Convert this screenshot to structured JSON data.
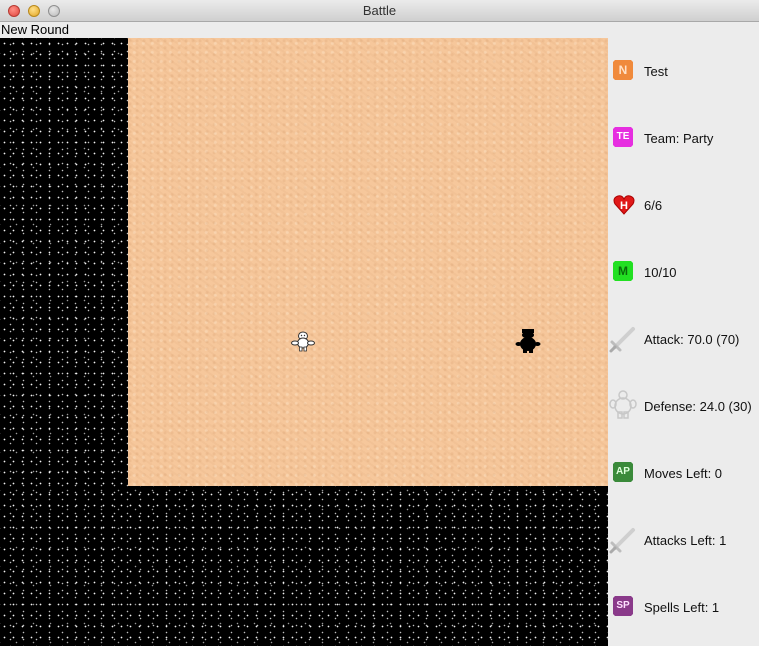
{
  "window": {
    "title": "Battle"
  },
  "menu": {
    "new_round": "New Round"
  },
  "stats": {
    "name": {
      "icon": "N",
      "label": "Test",
      "color": "#f08a3c"
    },
    "team": {
      "icon": "TE",
      "label": "Team: Party",
      "color": "#e62ee0"
    },
    "health": {
      "icon": "H",
      "label": "6/6",
      "color": "#e01818"
    },
    "mana": {
      "icon": "M",
      "label": "10/10",
      "color": "#22e022"
    },
    "attack": {
      "icon": "sword-icon",
      "label": "Attack: 70.0 (70)"
    },
    "defense": {
      "icon": "armor-icon",
      "label": "Defense: 24.0 (30)"
    },
    "moves": {
      "icon": "AP",
      "label": "Moves Left: 0",
      "color": "#3a8a3a"
    },
    "attacks": {
      "icon": "sword-icon",
      "label": "Attacks Left: 1"
    },
    "spells": {
      "icon": "SP",
      "label": "Spells Left: 1",
      "color": "#8a3a8a"
    }
  }
}
